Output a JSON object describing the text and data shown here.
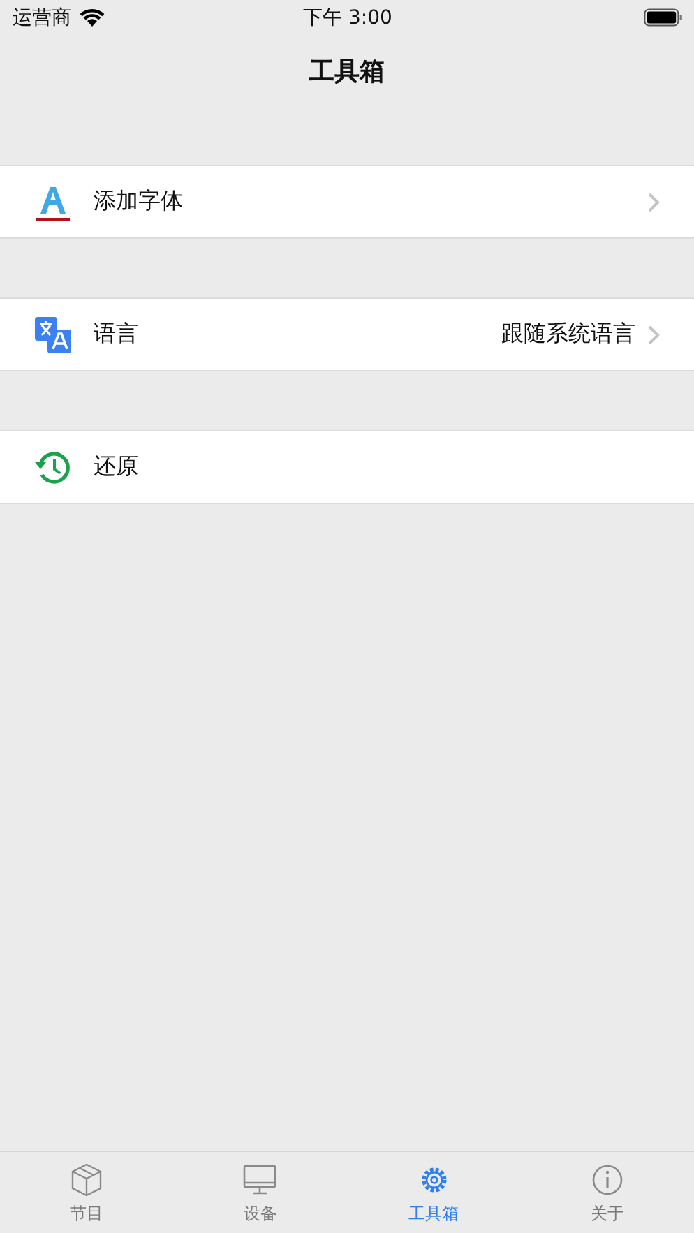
{
  "status_bar": {
    "carrier": "运营商",
    "time": "下午 3:00"
  },
  "nav": {
    "title": "工具箱"
  },
  "rows": [
    {
      "kind": "font",
      "label": "添加字体",
      "disclosure": true
    },
    {
      "kind": "language",
      "label": "语言",
      "value": "跟随系统语言",
      "disclosure": true
    },
    {
      "kind": "restore",
      "label": "还原",
      "disclosure": false
    }
  ],
  "tabs": [
    {
      "kind": "box",
      "label": "节目",
      "selected": false
    },
    {
      "kind": "monitor",
      "label": "设备",
      "selected": false
    },
    {
      "kind": "gear",
      "label": "工具箱",
      "selected": true
    },
    {
      "kind": "info",
      "label": "关于",
      "selected": false
    }
  ]
}
